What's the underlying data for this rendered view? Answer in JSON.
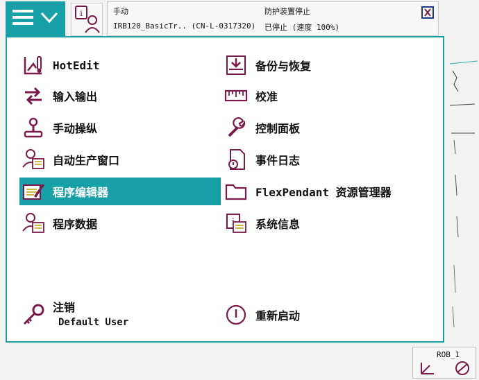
{
  "status": {
    "mode": "手动",
    "controller": "IRB120_BasicTr.. (CN-L-0317320)",
    "safety": "防护装置停止",
    "state": "已停止 (速度 100%)"
  },
  "menu": {
    "left": [
      {
        "label": "HotEdit",
        "icon": "hotedit-icon"
      },
      {
        "label": "输入输出",
        "icon": "io-icon"
      },
      {
        "label": "手动操纵",
        "icon": "joystick-icon"
      },
      {
        "label": "自动生产窗口",
        "icon": "production-window-icon"
      },
      {
        "label": "程序编辑器",
        "icon": "program-editor-icon",
        "selected": true
      },
      {
        "label": "程序数据",
        "icon": "program-data-icon"
      }
    ],
    "right": [
      {
        "label": "备份与恢复",
        "icon": "backup-restore-icon"
      },
      {
        "label": "校准",
        "icon": "calibration-icon"
      },
      {
        "label": "控制面板",
        "icon": "control-panel-icon"
      },
      {
        "label": "事件日志",
        "icon": "event-log-icon"
      },
      {
        "label": "FlexPendant 资源管理器",
        "icon": "folder-icon"
      },
      {
        "label": "系统信息",
        "icon": "system-info-icon"
      }
    ],
    "logout": {
      "label": "注销",
      "user": "Default User"
    },
    "restart": {
      "label": "重新启动"
    }
  },
  "rob": {
    "label": "ROB_1"
  },
  "colors": {
    "accent": "#18a0a8",
    "icon": "#7a1a4a"
  }
}
